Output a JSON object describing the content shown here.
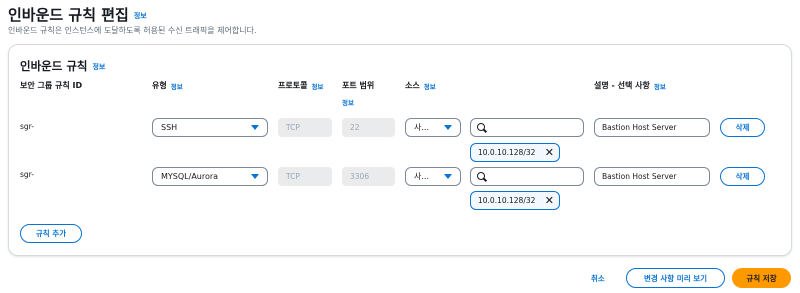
{
  "page": {
    "title": "인바운드 규칙 편집",
    "info": "정보",
    "description": "인바운드 규칙은 인스턴스에 도달하도록 허용된 수신 트래픽을 제어합니다."
  },
  "section": {
    "title": "인바운드 규칙",
    "info": "정보"
  },
  "columns": {
    "rule_id": "보안 그룹 규칙 ID",
    "type": "유형",
    "type_info": "정보",
    "protocol": "프로토콜",
    "protocol_info": "정보",
    "port_range": "포트 범위",
    "port_info": "정보",
    "source": "소스",
    "source_info": "정보",
    "description": "설명 - 선택 사항",
    "description_info": "정보"
  },
  "rules": [
    {
      "id": "sgr-",
      "type": "SSH",
      "protocol": "TCP",
      "port": "22",
      "source": "사...",
      "source_search": "",
      "source_token": "10.0.10.128/32",
      "description": "Bastion Host Server",
      "delete": "삭제"
    },
    {
      "id": "sgr-",
      "type": "MYSQL/Aurora",
      "protocol": "TCP",
      "port": "3306",
      "source": "사...",
      "source_search": "",
      "source_token": "10.0.10.128/32",
      "description": "Bastion Host Server",
      "delete": "삭제"
    }
  ],
  "actions": {
    "add_rule": "규칙 추가",
    "cancel": "취소",
    "preview": "변경 사항 미리 보기",
    "save": "규칙 저장"
  },
  "colors": {
    "accent": "#0972d3",
    "primary_button": "#ff9900",
    "disabled_bg": "#e9ebed"
  },
  "icons": {
    "search": "search-icon",
    "dropdown": "caret-down-icon",
    "remove": "close-icon"
  }
}
